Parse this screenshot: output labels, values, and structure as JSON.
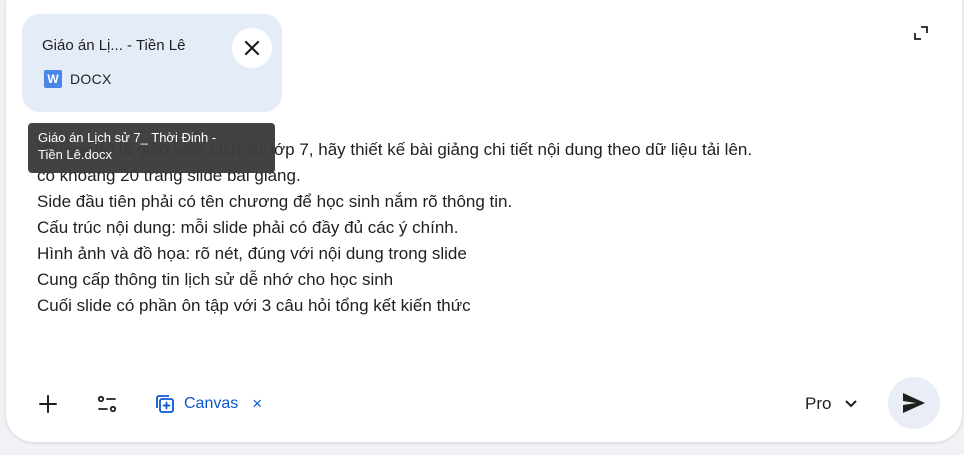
{
  "attachment": {
    "name": "Giáo án Lị... - Tiền Lê",
    "type_letter": "W",
    "type_label": "DOCX",
    "tooltip_line1": "Giáo án Lịch sử 7_ Thời Đinh -",
    "tooltip_line2": "Tiền Lê.docx"
  },
  "prompt": {
    "lines": [
      "Với vai trò là giáo viên Lịch sử lớp 7, hãy thiết kế bài giảng chi tiết nội dung theo dữ liệu tải lên.",
      "có khoảng 20 trang slide bài giảng.",
      "Side đầu tiên phải có tên chương để học sinh nắm rõ thông tin.",
      "Cấu trúc nội dung: mỗi slide phải có đầy đủ các ý chính.",
      "Hình ảnh và đồ họa: rõ nét, đúng với nội dung trong slide",
      "Cung cấp thông tin lịch sử dễ nhớ cho học sinh",
      "Cuối slide có phần ôn tập với 3 câu hỏi tổng kết kiến thức"
    ]
  },
  "toolbar": {
    "canvas_label": "Canvas",
    "canvas_remove": "×",
    "model_label": "Pro"
  },
  "icons": {
    "add": "plus-icon",
    "tools": "tune-icon",
    "canvas": "canvas-icon",
    "model_dropdown": "chevron-down-icon",
    "send": "send-icon",
    "expand": "expand-icon",
    "close": "close-icon"
  },
  "colors": {
    "accent": "#0b57d0",
    "attachment_bg": "#e4ecf7",
    "docx_icon": "#4a86e8",
    "tooltip_bg": "#3c3c3c",
    "send_bg": "#e9eef6"
  }
}
